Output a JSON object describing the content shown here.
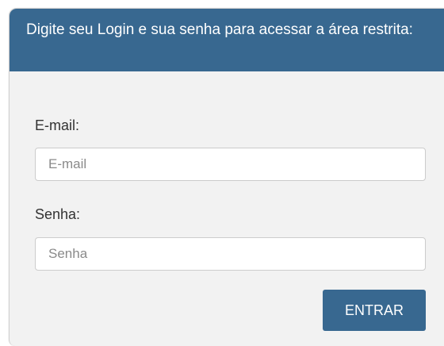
{
  "header": {
    "text": "Digite seu Login e sua senha para acessar a área restrita:"
  },
  "form": {
    "email": {
      "label": "E-mail:",
      "placeholder": "E-mail",
      "value": ""
    },
    "password": {
      "label": "Senha:",
      "placeholder": "Senha",
      "value": ""
    },
    "submit_label": "ENTRAR"
  },
  "colors": {
    "header_bg": "#386890",
    "panel_bg": "#f2f2f2",
    "button_bg": "#386890"
  }
}
